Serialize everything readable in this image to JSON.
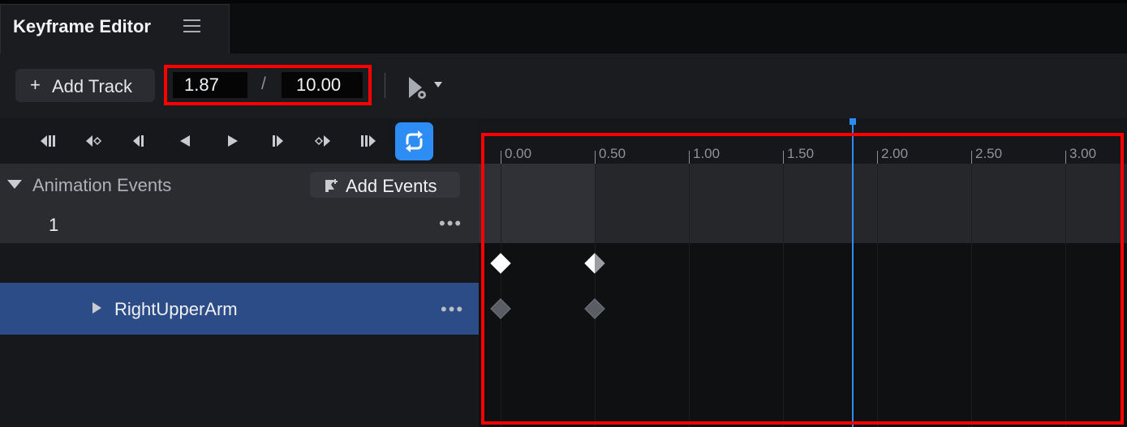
{
  "tab": {
    "title": "Keyframe Editor",
    "menu_icon": "hamburger-menu-icon"
  },
  "toolbar": {
    "add_track_label": "Add Track",
    "current_time": "1.87",
    "separator": "/",
    "total_time": "10.00",
    "play_settings_icon": "play-settings-icon"
  },
  "transport": {
    "buttons": [
      "first-keyframe-icon",
      "prev-keyframe-icon",
      "prev-frame-icon",
      "play-reverse-icon",
      "play-icon",
      "next-frame-icon",
      "next-keyframe-icon",
      "last-keyframe-icon",
      "loop-icon"
    ]
  },
  "events": {
    "header_label": "Animation Events",
    "add_events_label": "Add Events",
    "rows": [
      {
        "label": "1",
        "more": "•••"
      }
    ]
  },
  "tracks": [
    {
      "name": "RightUpperArm",
      "more": "•••"
    }
  ],
  "timeline": {
    "ticks": [
      "0.00",
      "0.50",
      "1.00",
      "1.50",
      "2.00",
      "2.50",
      "3.00"
    ],
    "playhead_time": 1.87,
    "keyframes_row1": [
      0.0,
      0.5
    ],
    "keyframes_row2": [
      0.0,
      0.5
    ]
  },
  "colors": {
    "accent": "#2e8cf5",
    "selection": "#2b4c86",
    "highlight_outline": "#ff0000"
  }
}
